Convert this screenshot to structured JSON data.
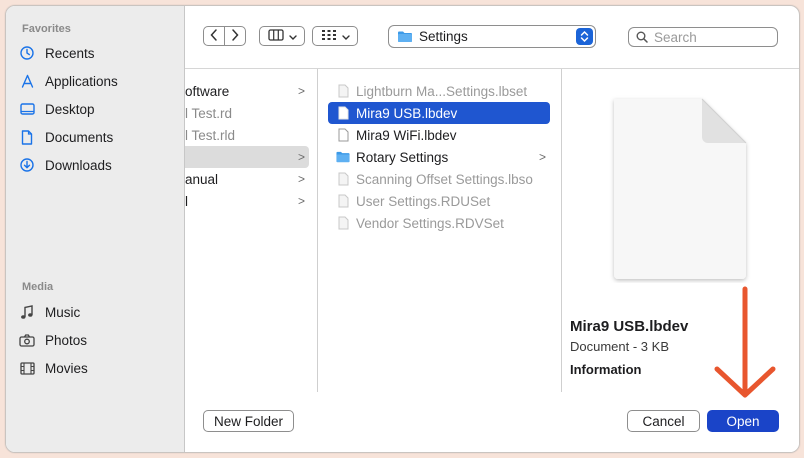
{
  "sidebar": {
    "favorites_heading": "Favorites",
    "favorites": [
      {
        "label": "Recents",
        "icon": "clock-icon"
      },
      {
        "label": "Applications",
        "icon": "applications-icon"
      },
      {
        "label": "Desktop",
        "icon": "desktop-icon"
      },
      {
        "label": "Documents",
        "icon": "document-icon"
      },
      {
        "label": "Downloads",
        "icon": "download-icon"
      }
    ],
    "media_heading": "Media",
    "media": [
      {
        "label": "Music",
        "icon": "music-icon"
      },
      {
        "label": "Photos",
        "icon": "camera-icon"
      },
      {
        "label": "Movies",
        "icon": "film-icon"
      }
    ]
  },
  "toolbar": {
    "location": "Settings",
    "search_placeholder": "Search"
  },
  "column1": {
    "items": [
      {
        "label": "oftware",
        "dim": false,
        "chevron": ">"
      },
      {
        "label": "l Test.rd",
        "dim": true,
        "chevron": ""
      },
      {
        "label": "l Test.rld",
        "dim": true,
        "chevron": ""
      },
      {
        "label": "",
        "dim": false,
        "chevron": ">"
      },
      {
        "label": "anual",
        "dim": false,
        "chevron": ">"
      },
      {
        "label": "l",
        "dim": false,
        "chevron": ">"
      }
    ]
  },
  "column2": {
    "items": [
      {
        "label": "Lightburn Ma...Settings.lbset",
        "type": "file",
        "dim": true
      },
      {
        "label": "Mira9 USB.lbdev",
        "type": "file",
        "dim": false,
        "selected": true
      },
      {
        "label": "Mira9 WiFi.lbdev",
        "type": "file",
        "dim": false
      },
      {
        "label": "Rotary Settings",
        "type": "folder",
        "dim": false,
        "chevron": ">"
      },
      {
        "label": "Scanning Offset Settings.lbso",
        "type": "file",
        "dim": true
      },
      {
        "label": "User Settings.RDUSet",
        "type": "file",
        "dim": true
      },
      {
        "label": "Vendor Settings.RDVSet",
        "type": "file",
        "dim": true
      }
    ]
  },
  "preview": {
    "name": "Mira9 USB.lbdev",
    "kind": "Document - 3 KB",
    "info_heading": "Information"
  },
  "buttons": {
    "new_folder": "New Folder",
    "cancel": "Cancel",
    "open": "Open"
  },
  "colors": {
    "accent": "#1a44c8",
    "selection": "#1f56d0",
    "annotation_arrow": "#e8562e",
    "background": "#f7e3d9"
  }
}
